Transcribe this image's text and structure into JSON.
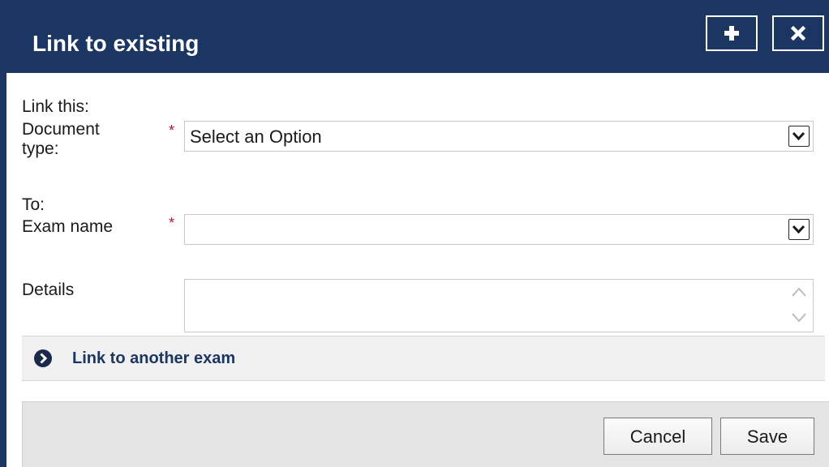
{
  "dialog": {
    "title": "Link to existing",
    "add_icon": "plus-icon",
    "close_icon": "close-icon"
  },
  "form": {
    "link_this_label": "Link this:",
    "document_type_label_line1": "Document",
    "document_type_label_line2": "type:",
    "document_type_required": "*",
    "document_type_value": "Select an Option",
    "to_label": "To:",
    "exam_name_label": "Exam name",
    "exam_name_required": "*",
    "exam_name_value": "",
    "details_label": "Details",
    "details_value": ""
  },
  "link_another": {
    "label": "Link to another exam",
    "icon": "chevron-right-circle-icon"
  },
  "footer": {
    "cancel_label": "Cancel",
    "save_label": "Save"
  },
  "colors": {
    "header_bg": "#1c3663",
    "required": "#c8102e",
    "link_text": "#1c3663"
  }
}
